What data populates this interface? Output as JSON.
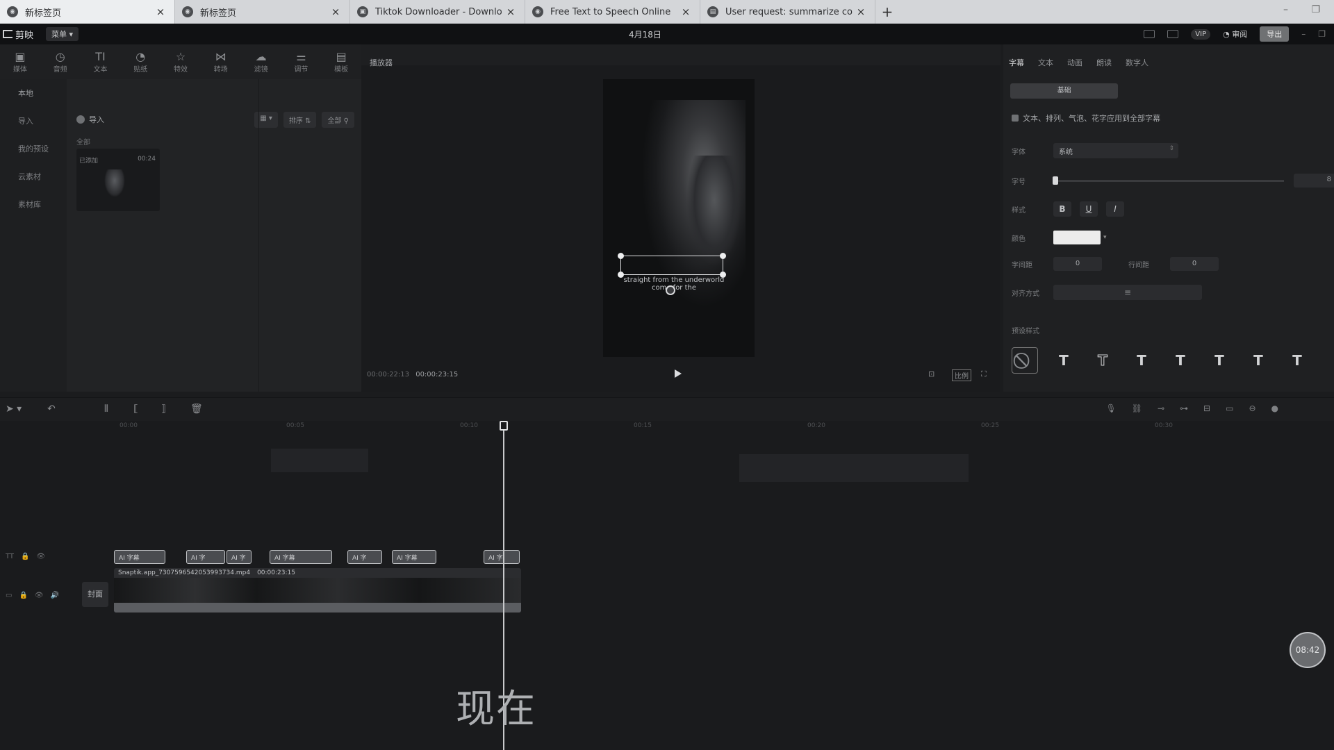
{
  "browser": {
    "tabs": [
      {
        "title": "新标签页",
        "active": true
      },
      {
        "title": "新标签页",
        "active": false
      },
      {
        "title": "Tiktok Downloader - Downlo",
        "active": false
      },
      {
        "title": "Free Text to Speech Online",
        "active": false
      },
      {
        "title": "User request: summarize co",
        "active": false
      }
    ],
    "new_tab": "+",
    "close": "×"
  },
  "app": {
    "name": "剪映",
    "menu": "菜单",
    "date": "4月18日",
    "vip": "VIP",
    "review": "审阅",
    "export": "导出"
  },
  "tools": [
    {
      "label": "媒体",
      "icon": "▣"
    },
    {
      "label": "音频",
      "icon": "◷"
    },
    {
      "label": "文本",
      "icon": "TI"
    },
    {
      "label": "贴纸",
      "icon": "◔"
    },
    {
      "label": "特效",
      "icon": "☆"
    },
    {
      "label": "转场",
      "icon": "⋈"
    },
    {
      "label": "滤镜",
      "icon": "☁"
    },
    {
      "label": "调节",
      "icon": "⚌"
    },
    {
      "label": "模板",
      "icon": "▤"
    }
  ],
  "sidebar": {
    "items": [
      "本地",
      "导入",
      "我的预设",
      "云素材",
      "素材库"
    ]
  },
  "media": {
    "import_label": "导入",
    "sort_label": "排序",
    "filter_label": "全部",
    "all_label": "全部",
    "clip_status": "已添加",
    "clip_duration": "00:24"
  },
  "player": {
    "title": "播放器",
    "subtitle_line1": "straight from the underworld",
    "subtitle_line2": "come for the",
    "current_time": "00:00:22:13",
    "total_time": "00:00:23:15",
    "ratio": "比例"
  },
  "props": {
    "tabs": [
      "字幕",
      "文本",
      "动画",
      "朗读",
      "数字人"
    ],
    "subtabs": [
      "基础",
      "",
      ""
    ],
    "apply_all": "文本、排列、气泡、花字应用到全部字幕",
    "font_label": "字体",
    "font_value": "系统",
    "size_label": "字号",
    "size_value": "8",
    "style_label": "样式",
    "style_buttons": [
      "B",
      "U",
      "I"
    ],
    "color_label": "颜色",
    "color_value": "#ececec",
    "spacing_label": "字间距",
    "spacing_value": "0",
    "line_label": "行间距",
    "line_value": "0",
    "align_label": "对齐方式",
    "align_icon": "≡",
    "preset_label": "预设样式",
    "presets": [
      "⃠",
      "T",
      "T",
      "T",
      "T",
      "T",
      "T",
      "T",
      "T"
    ]
  },
  "timeline": {
    "ticks": [
      "00:00",
      "00:05",
      "00:10",
      "00:15",
      "00:20",
      "00:25",
      "00:30"
    ],
    "text_clips": [
      {
        "label": "AI 字幕"
      },
      {
        "label": "AI 字"
      },
      {
        "label": "AI 字"
      },
      {
        "label": "AI 字幕"
      },
      {
        "label": "AI 字"
      },
      {
        "label": "AI 字幕"
      },
      {
        "label": "AI 字"
      }
    ],
    "video_clip_name": "Snaptik.app_7307596542053993734.mp4",
    "video_clip_duration": "00:00:23:15",
    "cover_label": "封面"
  },
  "overlay": {
    "caption": "现在",
    "timer": "08:42"
  }
}
